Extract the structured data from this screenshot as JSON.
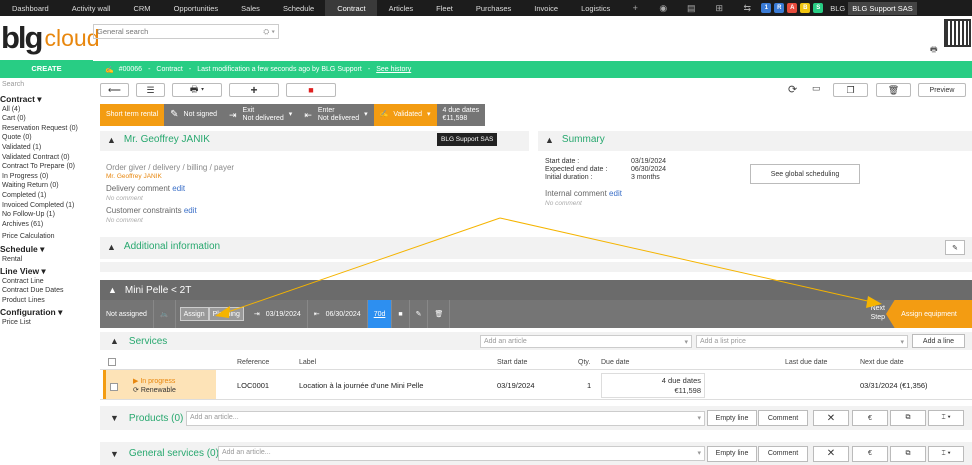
{
  "topnav": {
    "items": [
      "Dashboard",
      "Activity wall",
      "CRM",
      "Opportunities",
      "Sales",
      "Schedule",
      "Contract",
      "Articles",
      "Fleet",
      "Purchases",
      "Invoice",
      "Logistics"
    ],
    "active": "Contract",
    "badges": [
      "1",
      "R",
      "A",
      "B",
      "S"
    ],
    "badge_colors": [
      "#3a7bd5",
      "#3a7bd5",
      "#e74c3c",
      "#f1c40f",
      "#28cd84"
    ],
    "org": "BLG",
    "user": "BLG Support SAS"
  },
  "logo": {
    "brand": "blg",
    "suffix": "cloud"
  },
  "search": {
    "placeholder": "General search"
  },
  "sidebar": {
    "create": "CREATE",
    "search": "Search",
    "contract_header": "Contract ▾",
    "contract_items": [
      "All (4)",
      "Cart (0)",
      "Reservation Request (0)",
      "Quote (0)",
      "Validated (1)",
      "Validated Contract (0)",
      "Contract To Prepare (0)",
      "In Progress (0)",
      "Waiting Return (0)",
      "Completed (1)",
      "Invoiced Completed (1)",
      "No Follow-Up (1)",
      "Archives (61)"
    ],
    "price_calc": "Price Calculation",
    "schedule_header": "Schedule ▾",
    "schedule_items": [
      "Rental"
    ],
    "lineview_header": "Line View ▾",
    "lineview_items": [
      "Contract Line",
      "Contract Due Dates",
      "Product Lines"
    ],
    "config_header": "Configuration ▾",
    "config_items": [
      "Price List"
    ]
  },
  "breadcrumb": {
    "number": "#00066",
    "section": "Contract",
    "modified": "Last modification a few seconds ago by BLG Support",
    "history": "See history"
  },
  "toolbar": {
    "preview": "Preview"
  },
  "status": {
    "term": "Short term rental",
    "not_signed": "Not signed",
    "exit": "Exit",
    "exit_state": "Not delivered",
    "enter": "Enter",
    "enter_state": "Not delivered",
    "validated": "Validated",
    "due_dates": "4 due dates",
    "due_amount": "€11,598"
  },
  "customer": {
    "name": "Mr. Geoffrey JANIK",
    "tag": "BLG Support SAS",
    "roles": "Order giver / delivery / billing / payer",
    "roles_name": "Mr. Geoffrey JANIK",
    "delivery_comment": "Delivery comment",
    "edit": "edit",
    "no_comment": "No comment",
    "constraints": "Customer constraints"
  },
  "summary": {
    "title": "Summary",
    "start_label": "Start date :",
    "start": "03/19/2024",
    "end_label": "Expected end date :",
    "end": "06/30/2024",
    "duration_label": "Initial duration :",
    "duration": "3 months",
    "scheduling": "See global scheduling",
    "internal": "Internal comment",
    "edit": "edit",
    "no_comment": "No comment"
  },
  "additional": {
    "title": "Additional information"
  },
  "mini": {
    "title": "Mini Pelle < 2T",
    "not_assigned": "Not assigned",
    "assign": "Assign",
    "planning": "Planning",
    "start": "03/19/2024",
    "end": "06/30/2024",
    "days": "70d",
    "next": "Next",
    "step": "Step",
    "assign_equipment": "Assign equipment"
  },
  "services": {
    "title": "Services",
    "add_article": "Add an article",
    "add_price": "Add a list price",
    "add_line": "Add a line",
    "columns": [
      "Reference",
      "Label",
      "Start date",
      "Qty.",
      "Due date",
      "Last due date",
      "Next due date"
    ],
    "row": {
      "status": "In progress",
      "renewable": "Renewable",
      "ref": "LOC0001",
      "label": "Location à la journée d'une Mini Pelle",
      "start": "03/19/2024",
      "qty": "1",
      "due_dates": "4 due dates",
      "amount": "€11,598",
      "next": "03/31/2024 (€1,356)"
    }
  },
  "products": {
    "title": "Products (0)",
    "add_article": "Add an article...",
    "empty": "Empty line",
    "comment": "Comment"
  },
  "general": {
    "title": "General services (0)",
    "add_article": "Add an article...",
    "empty": "Empty line",
    "comment": "Comment"
  }
}
